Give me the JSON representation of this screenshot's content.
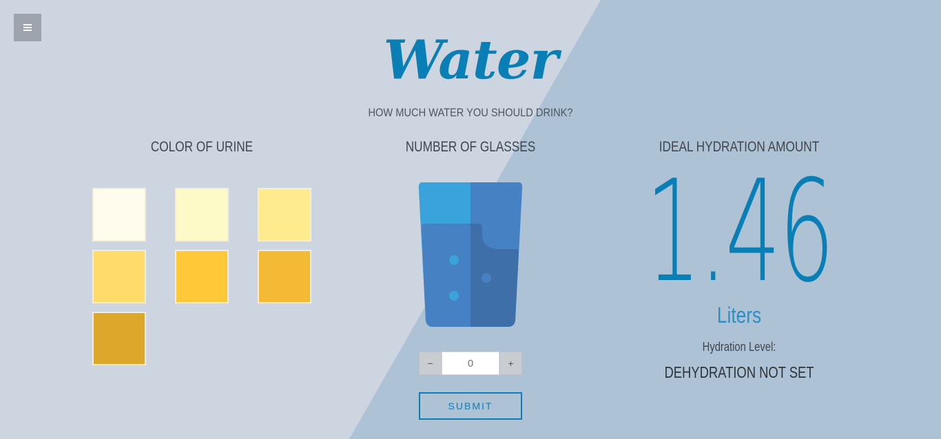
{
  "app": {
    "title": "Water",
    "subtitle": "HOW MUCH WATER YOU SHOULD DRINK?"
  },
  "menu": {
    "icon": "hamburger-icon"
  },
  "columns": {
    "urine": "COLOR OF URINE",
    "glasses": "NUMBER OF GLASSES",
    "ideal": "IDEAL HYDRATION AMOUNT"
  },
  "urine_colors": [
    "#fffced",
    "#fefac7",
    "#feeb8e",
    "#fedb6a",
    "#fec838",
    "#f4b935",
    "#dda72b"
  ],
  "stepper": {
    "minus_label": "−",
    "value": "0",
    "plus_label": "+"
  },
  "submit_label": "SUBMIT",
  "result": {
    "amount": "1.46",
    "unit": "Liters",
    "level_label": "Hydration Level:",
    "level_value": "DEHYDRATION NOT SET"
  },
  "colors": {
    "accent": "#0a7fb5",
    "bg_left": "#cdd5e1",
    "bg_right": "#aec2d5"
  }
}
